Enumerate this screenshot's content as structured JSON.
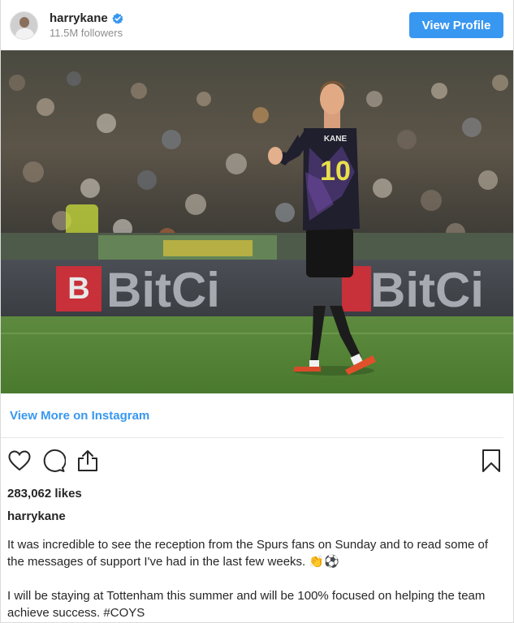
{
  "header": {
    "username": "harrykane",
    "followers": "11.5M followers",
    "view_profile_label": "View Profile"
  },
  "photo": {
    "banner_text": "BitCi",
    "banner_letter": "B",
    "shirt_name": "KANE",
    "shirt_number": "10"
  },
  "view_more_label": "View More on Instagram",
  "post": {
    "likes": "283,062 likes",
    "caption_username": "harrykane",
    "caption_paragraph_1": "It was incredible to see the reception from the Spurs fans on Sunday and to read some of the messages of support I've had in the last few weeks.",
    "caption_emoji_1": "👏⚽",
    "caption_paragraph_2": "I will be staying at Tottenham this summer and will be 100% focused on helping the team achieve success. #COYS"
  },
  "icons": {
    "verified": "verified-badge-icon",
    "like": "heart-icon",
    "comment": "comment-icon",
    "share": "share-icon",
    "save": "bookmark-icon"
  },
  "colors": {
    "accent": "#3897f0",
    "text": "#262626",
    "muted": "#8e8e8e"
  }
}
